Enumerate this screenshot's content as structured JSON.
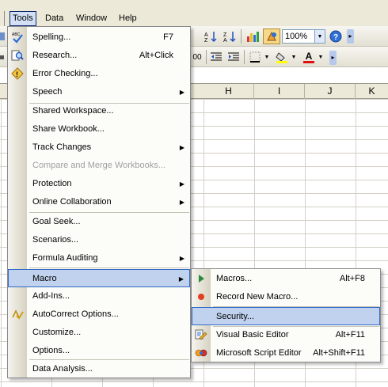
{
  "menubar": {
    "items": [
      {
        "label": "Tools",
        "active": true
      },
      {
        "label": "Data"
      },
      {
        "label": "Window"
      },
      {
        "label": "Help"
      }
    ]
  },
  "toolbar1": {
    "zoom_value": "100%",
    "zoom_arrow": "▼",
    "chevron": "▸",
    "sort_asc_text": "A↓Z",
    "sort_desc_text": "Z↓A"
  },
  "toolbar2": {
    "font_color_letter": "A",
    "arrow": "▼",
    "chevron": "▸",
    "frag_text": "00",
    "frag_text2": ".0"
  },
  "sheet": {
    "columns": [
      "H",
      "I",
      "J",
      "K"
    ]
  },
  "tools_menu": {
    "items": [
      {
        "label": "Spelling...",
        "shortcut": "F7",
        "icon": "spelling-icon"
      },
      {
        "label": "Research...",
        "shortcut": "Alt+Click",
        "icon": "research-icon"
      },
      {
        "label": "Error Checking...",
        "icon": "error-checking-icon"
      },
      {
        "label": "Speech",
        "submenu": true
      },
      {
        "label": "Shared Workspace..."
      },
      {
        "label": "Share Workbook..."
      },
      {
        "label": "Track Changes",
        "submenu": true
      },
      {
        "label": "Compare and Merge Workbooks...",
        "disabled": true
      },
      {
        "label": "Protection",
        "submenu": true
      },
      {
        "label": "Online Collaboration",
        "submenu": true
      },
      {
        "label": "Goal Seek..."
      },
      {
        "label": "Scenarios..."
      },
      {
        "label": "Formula Auditing",
        "submenu": true
      },
      {
        "label": "Macro",
        "submenu": true,
        "highlighted": true
      },
      {
        "label": "Add-Ins..."
      },
      {
        "label": "AutoCorrect Options...",
        "icon": "autocorrect-icon"
      },
      {
        "label": "Customize..."
      },
      {
        "label": "Options..."
      },
      {
        "label": "Data Analysis..."
      }
    ],
    "arrow_glyph": "▶"
  },
  "macro_submenu": {
    "items": [
      {
        "label": "Macros...",
        "shortcut": "Alt+F8",
        "icon": "run-macro-icon"
      },
      {
        "label": "Record New Macro...",
        "icon": "record-icon"
      },
      {
        "label": "Security...",
        "highlighted": true
      },
      {
        "label": "Visual Basic Editor",
        "shortcut": "Alt+F11",
        "icon": "vb-editor-icon"
      },
      {
        "label": "Microsoft Script Editor",
        "shortcut": "Alt+Shift+F11",
        "icon": "script-editor-icon"
      }
    ]
  },
  "colors": {
    "highlight_bg": "#c1d2ee",
    "highlight_border": "#316ac5",
    "menubar_bg": "#ece9d8",
    "disabled_text": "#a0a0a0"
  }
}
